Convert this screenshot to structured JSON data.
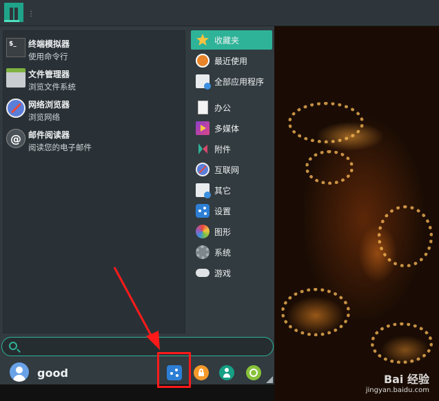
{
  "favorites": [
    {
      "name": "终端模拟器",
      "desc": "使用命令行",
      "icon": "terminal-icon"
    },
    {
      "name": "文件管理器",
      "desc": "浏览文件系统",
      "icon": "file-manager-icon"
    },
    {
      "name": "网络浏览器",
      "desc": "浏览网络",
      "icon": "web-browser-icon"
    },
    {
      "name": "邮件阅读器",
      "desc": "阅读您的电子邮件",
      "icon": "mail-icon"
    }
  ],
  "categories": [
    {
      "label": "收藏夹",
      "icon": "star-icon",
      "active": true
    },
    {
      "label": "最近使用",
      "icon": "recent-icon"
    },
    {
      "label": "全部应用程序",
      "icon": "all-apps-icon"
    },
    {
      "label": "办公",
      "icon": "office-icon"
    },
    {
      "label": "多媒体",
      "icon": "multimedia-icon"
    },
    {
      "label": "附件",
      "icon": "accessories-icon"
    },
    {
      "label": "互联网",
      "icon": "internet-icon"
    },
    {
      "label": "其它",
      "icon": "other-icon"
    },
    {
      "label": "设置",
      "icon": "settings-icon"
    },
    {
      "label": "图形",
      "icon": "graphics-icon"
    },
    {
      "label": "系统",
      "icon": "system-icon"
    },
    {
      "label": "游戏",
      "icon": "games-icon"
    }
  ],
  "user": {
    "name": "good"
  },
  "terminal_glyph": "$_",
  "mail_glyph": "@",
  "watermark": {
    "brand": "Bai 经验",
    "url": "jingyan.baidu.com"
  },
  "colors": {
    "accent": "#2eb398",
    "highlight": "#ff1a1a",
    "panel": "#2f363b",
    "menu": "#323b40"
  }
}
